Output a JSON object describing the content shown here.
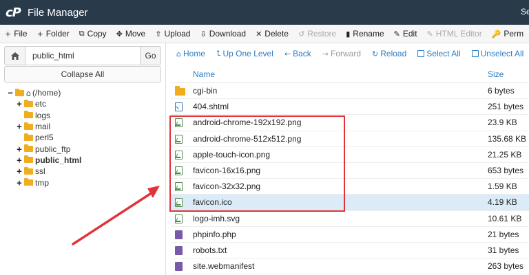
{
  "app": {
    "title": "File Manager",
    "logo": "cP",
    "header_right": "Se"
  },
  "toolbar": [
    {
      "icon": "+",
      "label": "File",
      "disabled": false
    },
    {
      "icon": "+",
      "label": "Folder",
      "disabled": false
    },
    {
      "icon": "⧉",
      "label": "Copy",
      "disabled": false
    },
    {
      "icon": "✥",
      "label": "Move",
      "disabled": false
    },
    {
      "icon": "⇧",
      "label": "Upload",
      "disabled": false
    },
    {
      "icon": "⇩",
      "label": "Download",
      "disabled": false
    },
    {
      "icon": "✕",
      "label": "Delete",
      "disabled": false
    },
    {
      "icon": "↺",
      "label": "Restore",
      "disabled": true
    },
    {
      "icon": "▮",
      "label": "Rename",
      "disabled": false
    },
    {
      "icon": "✎",
      "label": "Edit",
      "disabled": false
    },
    {
      "icon": "✎",
      "label": "HTML Editor",
      "disabled": true
    },
    {
      "icon": "🔑",
      "label": "Perm",
      "disabled": false
    }
  ],
  "sidebar": {
    "path_value": "public_html",
    "go_label": "Go",
    "collapse_label": "Collapse All",
    "tree": [
      {
        "toggle": "−",
        "icon": "home",
        "label": "(/home)",
        "bold": false,
        "indent": 0
      },
      {
        "toggle": "+",
        "icon": "folder",
        "label": "etc",
        "bold": false,
        "indent": 1
      },
      {
        "toggle": "",
        "icon": "folder",
        "label": "logs",
        "bold": false,
        "indent": 1
      },
      {
        "toggle": "+",
        "icon": "folder",
        "label": "mail",
        "bold": false,
        "indent": 1
      },
      {
        "toggle": "",
        "icon": "folder",
        "label": "perl5",
        "bold": false,
        "indent": 1
      },
      {
        "toggle": "+",
        "icon": "folder",
        "label": "public_ftp",
        "bold": false,
        "indent": 1
      },
      {
        "toggle": "+",
        "icon": "folder",
        "label": "public_html",
        "bold": true,
        "indent": 1
      },
      {
        "toggle": "+",
        "icon": "folder",
        "label": "ssl",
        "bold": false,
        "indent": 1
      },
      {
        "toggle": "+",
        "icon": "folder",
        "label": "tmp",
        "bold": false,
        "indent": 1
      }
    ]
  },
  "nav": [
    {
      "icon": "⌂",
      "label": "Home",
      "disabled": false
    },
    {
      "icon": "⮤",
      "label": "Up One Level",
      "disabled": false
    },
    {
      "icon": "←",
      "label": "Back",
      "disabled": false
    },
    {
      "icon": "→",
      "label": "Forward",
      "disabled": true
    },
    {
      "icon": "↻",
      "label": "Reload",
      "disabled": false
    },
    {
      "icon": "check",
      "label": "Select All",
      "disabled": false
    },
    {
      "icon": "box",
      "label": "Unselect All",
      "disabled": false
    }
  ],
  "table": {
    "headers": {
      "name": "Name",
      "size": "Size"
    },
    "rows": [
      {
        "type": "folder",
        "name": "cgi-bin",
        "size": "6 bytes",
        "selected": false
      },
      {
        "type": "code",
        "name": "404.shtml",
        "size": "251 bytes",
        "selected": false
      },
      {
        "type": "image",
        "name": "android-chrome-192x192.png",
        "size": "23.9 KB",
        "selected": false
      },
      {
        "type": "image",
        "name": "android-chrome-512x512.png",
        "size": "135.68 KB",
        "selected": false
      },
      {
        "type": "image",
        "name": "apple-touch-icon.png",
        "size": "21.25 KB",
        "selected": false
      },
      {
        "type": "image",
        "name": "favicon-16x16.png",
        "size": "653 bytes",
        "selected": false
      },
      {
        "type": "image",
        "name": "favicon-32x32.png",
        "size": "1.59 KB",
        "selected": false
      },
      {
        "type": "image",
        "name": "favicon.ico",
        "size": "4.19 KB",
        "selected": true
      },
      {
        "type": "image",
        "name": "logo-imh.svg",
        "size": "10.61 KB",
        "selected": false
      },
      {
        "type": "text",
        "name": "phpinfo.php",
        "size": "21 bytes",
        "selected": false
      },
      {
        "type": "text",
        "name": "robots.txt",
        "size": "31 bytes",
        "selected": false
      },
      {
        "type": "text",
        "name": "site.webmanifest",
        "size": "263 bytes",
        "selected": false
      }
    ]
  },
  "colors": {
    "header_bg": "#293a4a",
    "accent": "#2d7cc1",
    "annotation": "#e0333a",
    "selected_row": "#dbecf8"
  }
}
